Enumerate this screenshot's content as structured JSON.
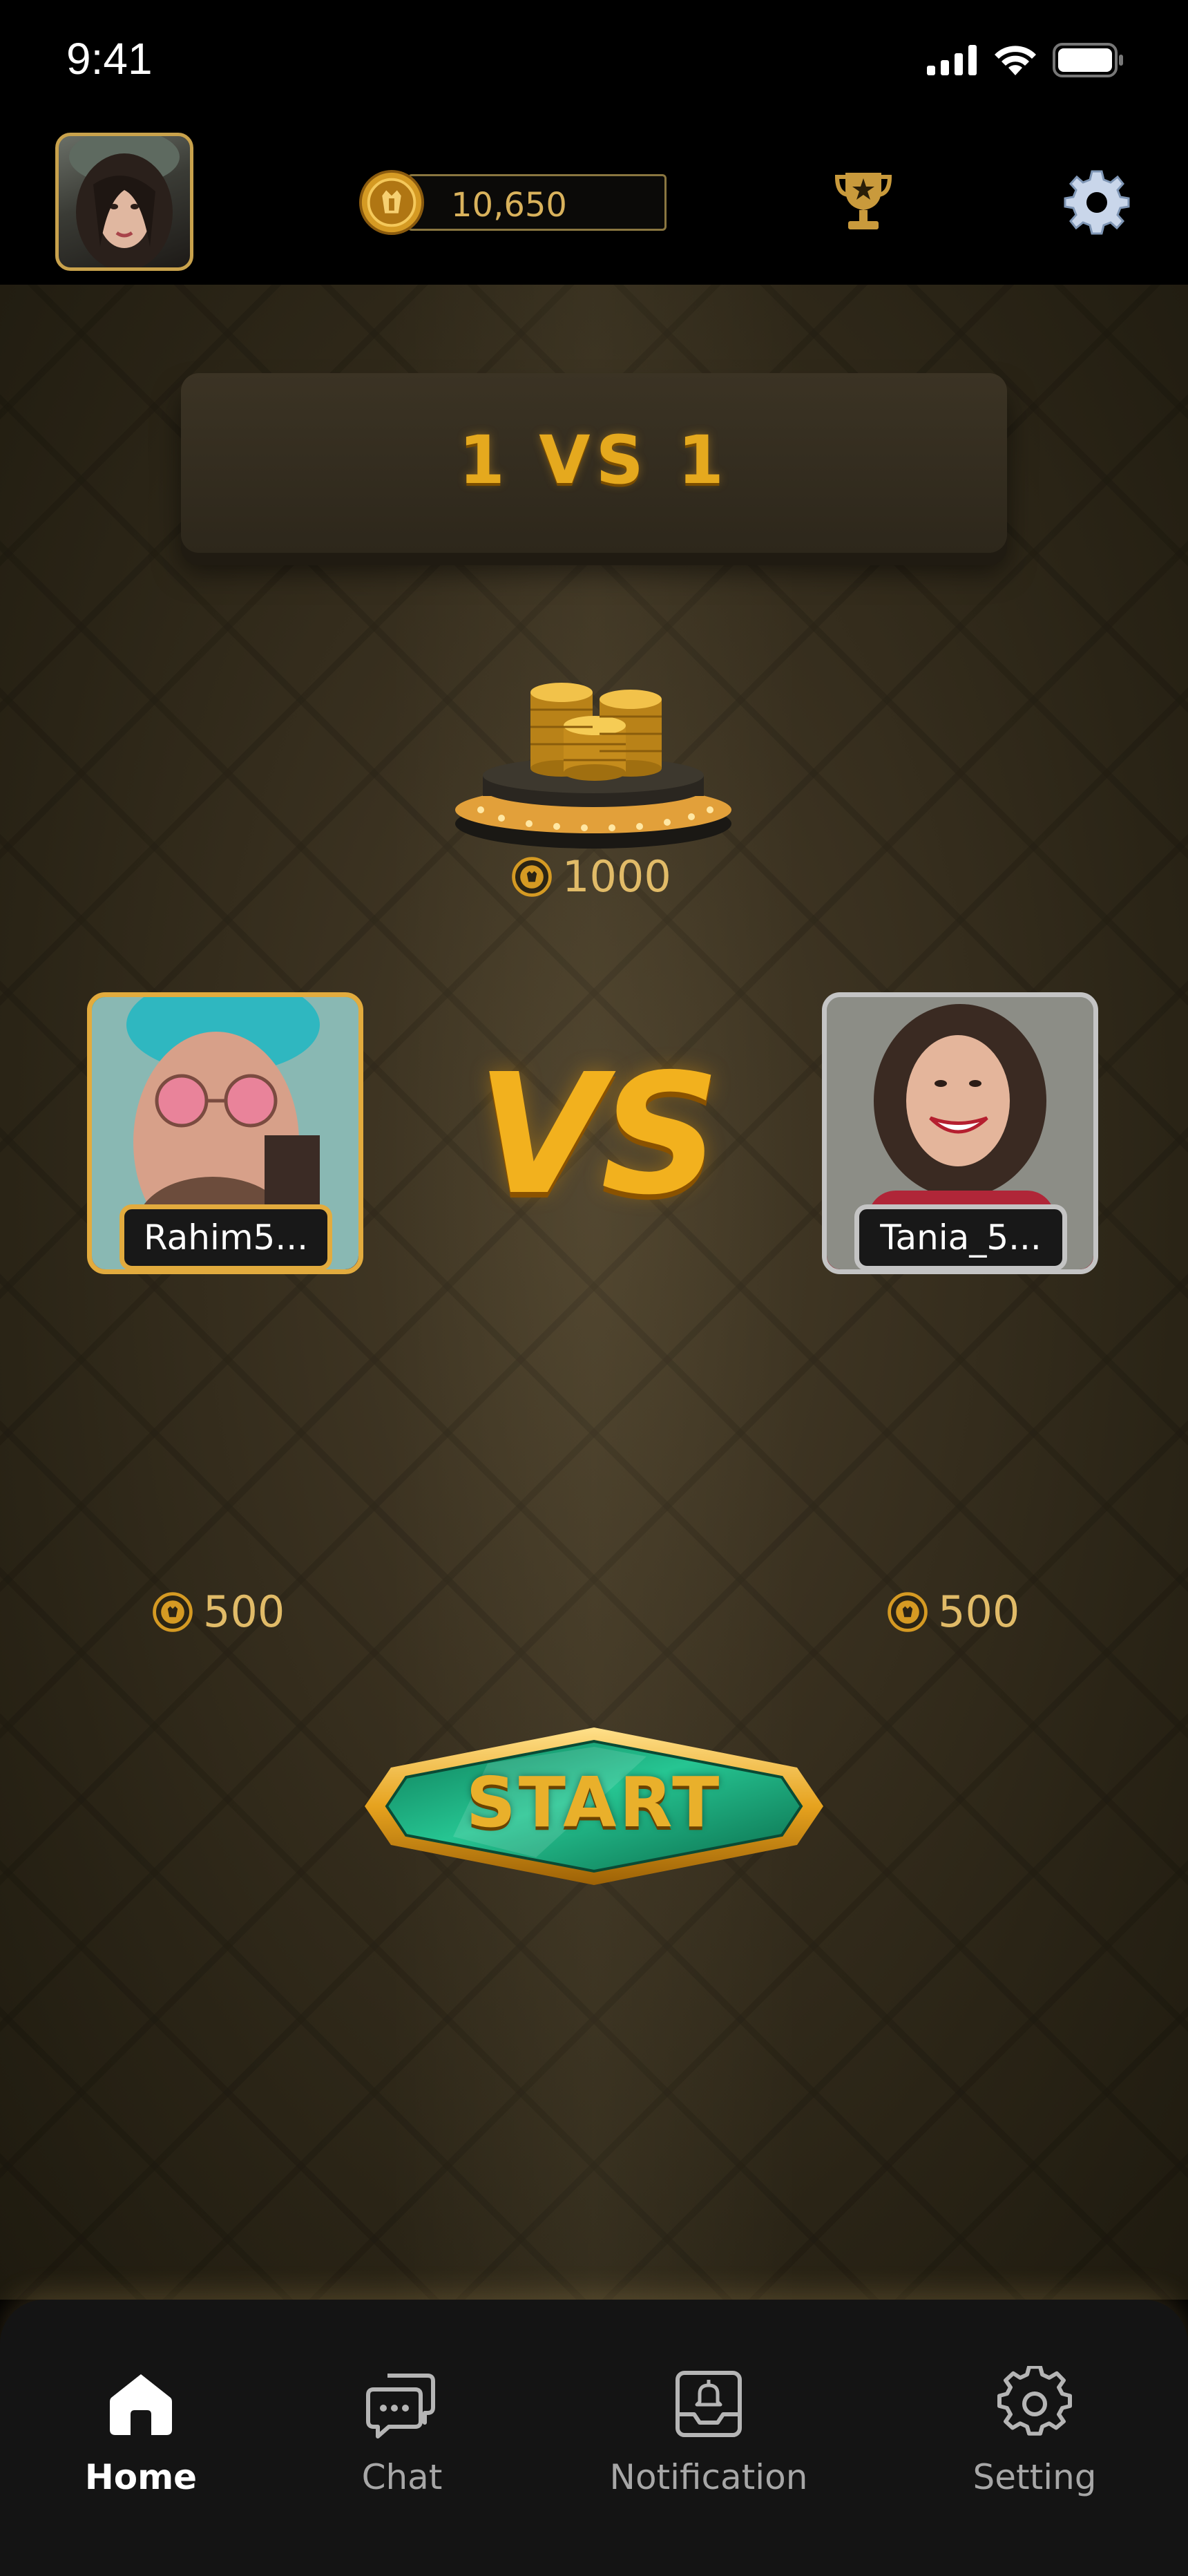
{
  "status_bar": {
    "time": "9:41"
  },
  "top_bar": {
    "coin_balance": "10,650"
  },
  "game": {
    "mode_title": "1 VS 1",
    "prize_amount": "1000",
    "vs_label": "VS",
    "start_label": "START",
    "players": [
      {
        "name": "Rahim5...",
        "bet": "500"
      },
      {
        "name": "Tania_5...",
        "bet": "500"
      }
    ]
  },
  "bottom_nav": {
    "items": [
      {
        "label": "Home",
        "icon": "home-icon",
        "active": true
      },
      {
        "label": "Chat",
        "icon": "chat-icon",
        "active": false
      },
      {
        "label": "Notification",
        "icon": "notification-icon",
        "active": false
      },
      {
        "label": "Setting",
        "icon": "settings-icon",
        "active": false
      }
    ]
  },
  "colors": {
    "accent_gold": "#e2ab3e",
    "start_green": "#17a878",
    "background_dark": "#2a2416"
  }
}
